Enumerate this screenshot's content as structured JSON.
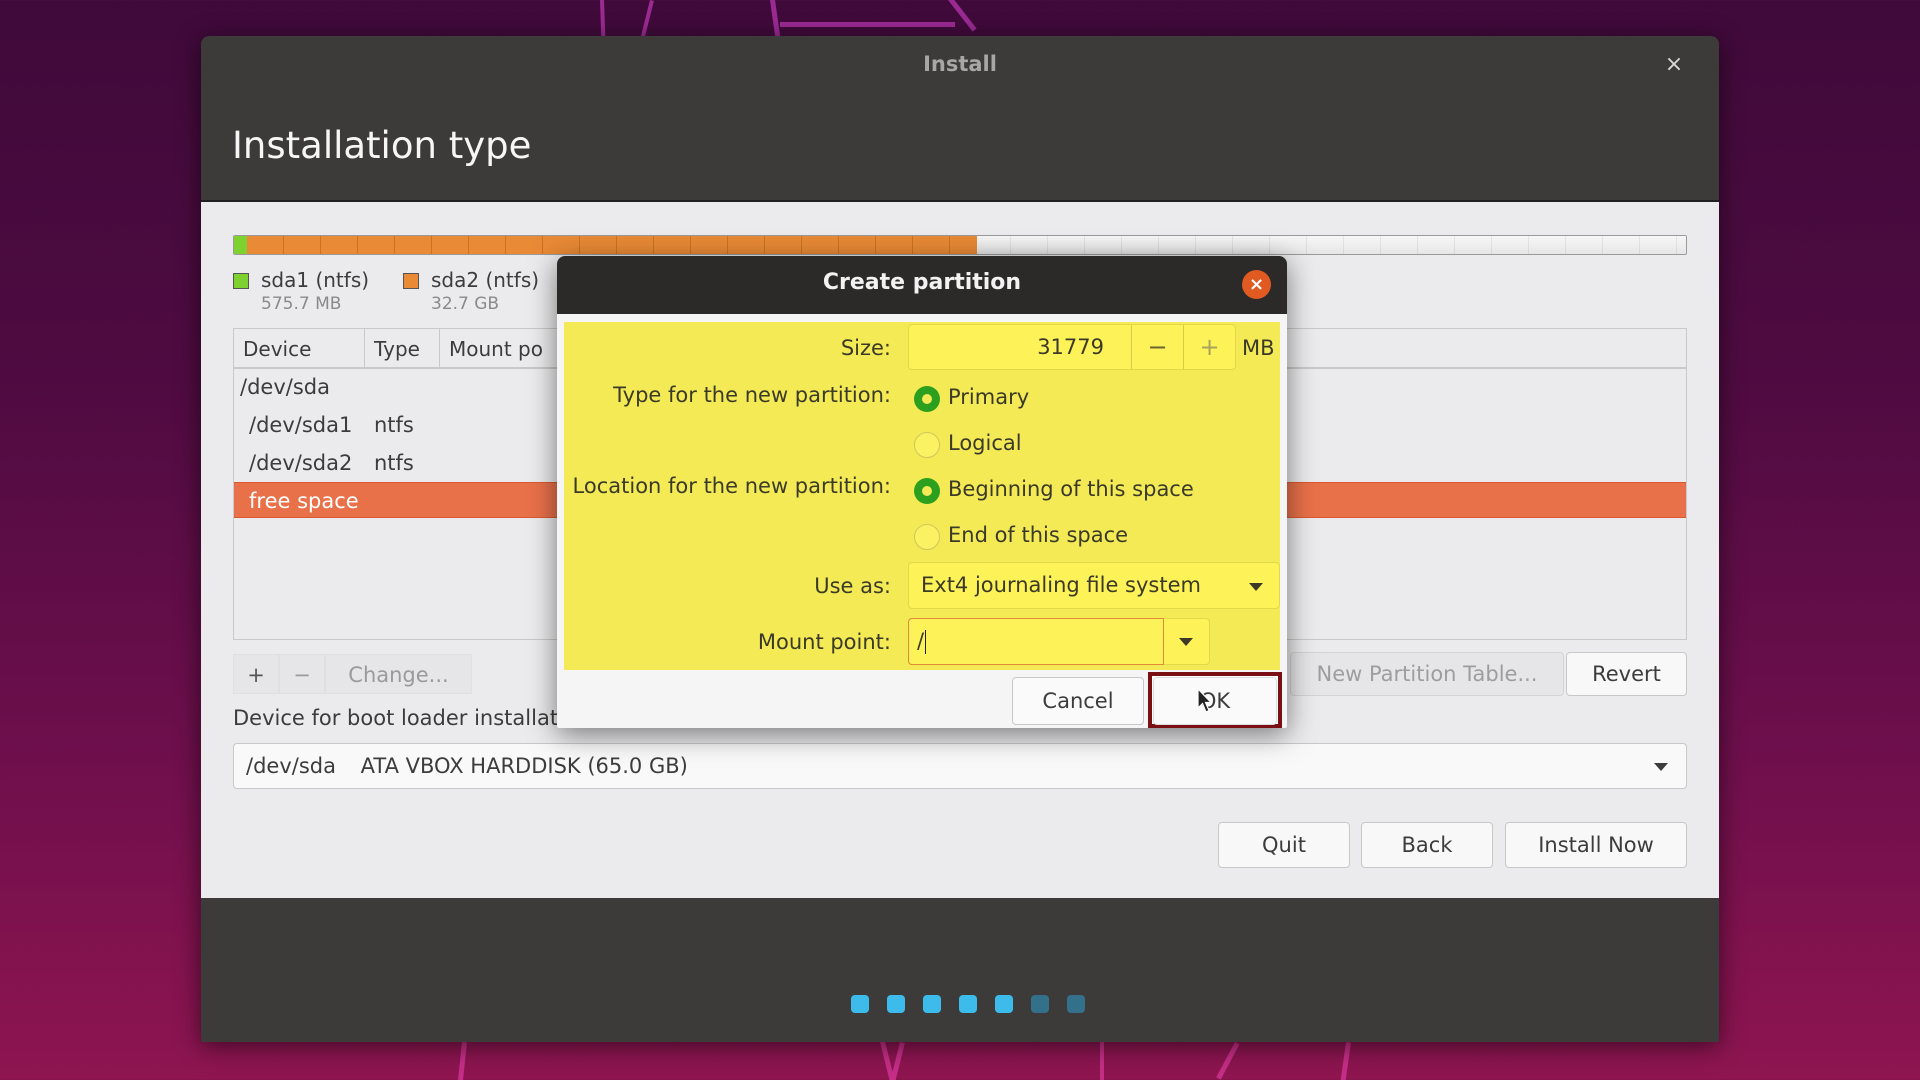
{
  "window": {
    "title": "Install",
    "close_glyph": "×",
    "page_title": "Installation type"
  },
  "partition_bar": {
    "segments": [
      {
        "name": "sda1",
        "fraction": 0.009,
        "color": "#7fd12f"
      },
      {
        "name": "sda2",
        "fraction": 0.503,
        "color": "#e98a36"
      },
      {
        "name": "free",
        "fraction": 0.488,
        "color": "#f2f2f2"
      }
    ]
  },
  "legend": [
    {
      "name": "sda1 (ntfs)",
      "size": "575.7 MB",
      "color": "#7fd12f"
    },
    {
      "name": "sda2 (ntfs)",
      "size": "32.7 GB",
      "color": "#e98a36"
    }
  ],
  "table": {
    "columns": [
      "Device",
      "Type",
      "Mount po"
    ],
    "rows": [
      {
        "device": "/dev/sda",
        "type": "",
        "selected": false
      },
      {
        "device": "/dev/sda1",
        "type": "ntfs",
        "selected": false
      },
      {
        "device": "/dev/sda2",
        "type": "ntfs",
        "selected": false
      },
      {
        "device": "free space",
        "type": "",
        "selected": true
      }
    ]
  },
  "table_buttons": {
    "add": "+",
    "remove": "−",
    "change": "Change...",
    "new_table": "New Partition Table...",
    "revert": "Revert"
  },
  "bootloader": {
    "label": "Device for boot loader installation:",
    "device": "/dev/sda",
    "description": "ATA VBOX HARDDISK (65.0 GB)"
  },
  "nav_buttons": {
    "quit": "Quit",
    "back": "Back",
    "install_now": "Install Now"
  },
  "progress_dots": {
    "total": 7,
    "completed": 5,
    "active_color": "#3dbbeb",
    "inactive_color": "#33718a"
  },
  "dialog": {
    "title": "Create partition",
    "close_glyph": "×",
    "size_label": "Size:",
    "size_value": "31779",
    "size_unit": "MB",
    "decrement": "−",
    "increment": "+",
    "type_label": "Type for the new partition:",
    "type_options": [
      {
        "label": "Primary",
        "selected": true
      },
      {
        "label": "Logical",
        "selected": false
      }
    ],
    "location_label": "Location for the new partition:",
    "location_options": [
      {
        "label": "Beginning of this space",
        "selected": true
      },
      {
        "label": "End of this space",
        "selected": false
      }
    ],
    "use_as_label": "Use as:",
    "use_as_value": "Ext4 journaling file system",
    "mount_label": "Mount point:",
    "mount_value": "/",
    "cancel": "Cancel",
    "ok": "OK"
  },
  "colors": {
    "accent": "#e9714a",
    "dialog_highlight": "#f3ea55",
    "ok_outline": "#7a0f14",
    "radio_on": "#2c9f1e"
  }
}
